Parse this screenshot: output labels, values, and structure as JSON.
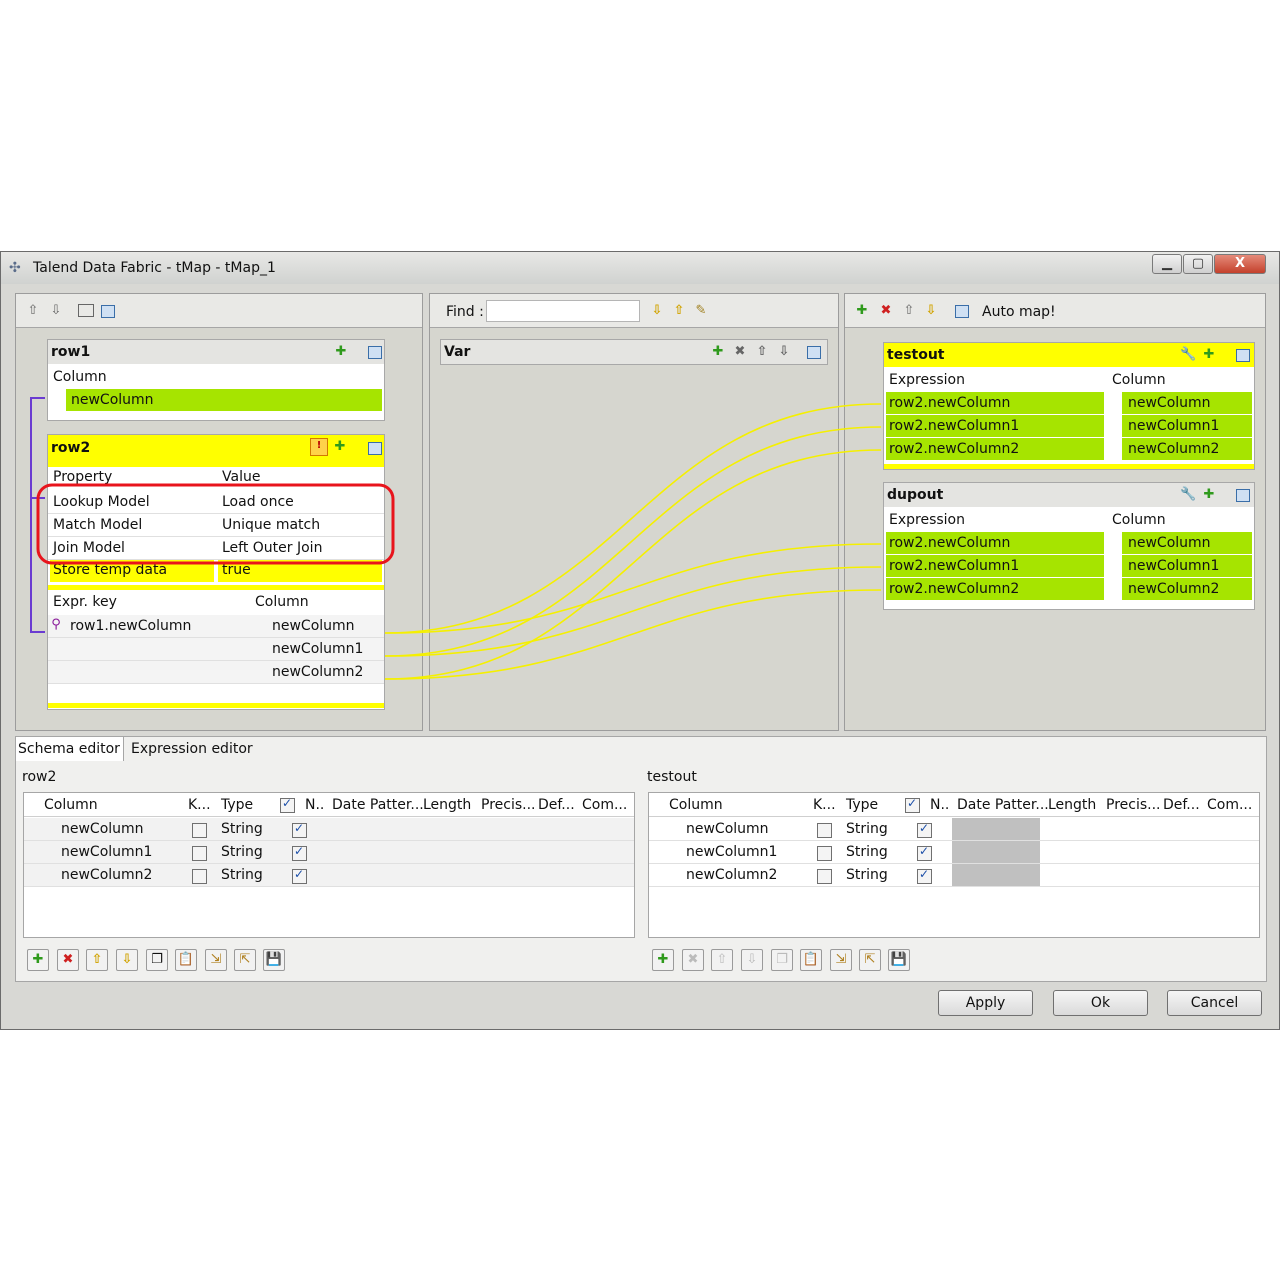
{
  "window": {
    "title": "Talend Data Fabric - tMap - tMap_1",
    "controls": {
      "minimize": "▁",
      "maximize": "▢",
      "close": "X"
    }
  },
  "middle": {
    "find_label": "Find :",
    "find_value": "",
    "var_title": "Var"
  },
  "right_toolbar": {
    "auto_map": "Auto map!"
  },
  "row1": {
    "title": "row1",
    "column_header": "Column",
    "rows": [
      "newColumn"
    ]
  },
  "row2": {
    "title": "row2",
    "prop_header": "Property",
    "value_header": "Value",
    "properties": [
      {
        "property": "Lookup Model",
        "value": "Load once"
      },
      {
        "property": "Match Model",
        "value": "Unique match"
      },
      {
        "property": "Join Model",
        "value": "Left Outer Join"
      },
      {
        "property": "Store temp data",
        "value": "true"
      }
    ],
    "expr_header": "Expr. key",
    "column_header": "Column",
    "rows": [
      {
        "expr": "row1.newColumn",
        "column": "newColumn"
      },
      {
        "expr": "",
        "column": "newColumn1"
      },
      {
        "expr": "",
        "column": "newColumn2"
      }
    ]
  },
  "testout": {
    "title": "testout",
    "expr_header": "Expression",
    "column_header": "Column",
    "rows": [
      {
        "expr": "row2.newColumn",
        "column": "newColumn"
      },
      {
        "expr": "row2.newColumn1",
        "column": "newColumn1"
      },
      {
        "expr": "row2.newColumn2",
        "column": "newColumn2"
      }
    ]
  },
  "dupout": {
    "title": "dupout",
    "expr_header": "Expression",
    "column_header": "Column",
    "rows": [
      {
        "expr": "row2.newColumn",
        "column": "newColumn"
      },
      {
        "expr": "row2.newColumn1",
        "column": "newColumn1"
      },
      {
        "expr": "row2.newColumn2",
        "column": "newColumn2"
      }
    ]
  },
  "tabs": [
    "Schema editor",
    "Expression editor"
  ],
  "schema_left": {
    "title": "row2",
    "headers": [
      "Column",
      "K...",
      "Type",
      "N..",
      "Date Patter...",
      "Length",
      "Precis...",
      "Def...",
      "Com..."
    ],
    "rows": [
      {
        "column": "newColumn",
        "key": false,
        "type": "String",
        "nullable": true
      },
      {
        "column": "newColumn1",
        "key": false,
        "type": "String",
        "nullable": true
      },
      {
        "column": "newColumn2",
        "key": false,
        "type": "String",
        "nullable": true
      }
    ]
  },
  "schema_right": {
    "title": "testout",
    "headers": [
      "Column",
      "K...",
      "Type",
      "N..",
      "Date Patter...",
      "Length",
      "Precis...",
      "Def...",
      "Com..."
    ],
    "rows": [
      {
        "column": "newColumn",
        "key": false,
        "type": "String",
        "nullable": true
      },
      {
        "column": "newColumn1",
        "key": false,
        "type": "String",
        "nullable": true
      },
      {
        "column": "newColumn2",
        "key": false,
        "type": "String",
        "nullable": true
      }
    ]
  },
  "buttons": {
    "apply": "Apply",
    "ok": "Ok",
    "cancel": "Cancel"
  },
  "colors": {
    "yellow": "#ffff00",
    "green": "#a6e400",
    "highlight": "#e8141c",
    "link": "#ffff00"
  }
}
